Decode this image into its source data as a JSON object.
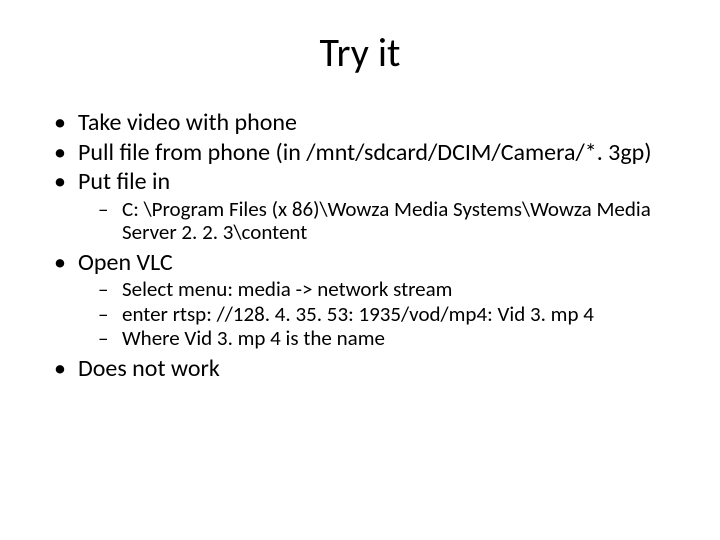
{
  "title": "Try it",
  "bullets": {
    "b1": "Take video with phone",
    "b2": "Pull file from phone (in /mnt/sdcard/DCIM/Camera/*. 3gp)",
    "b3": "Put file in",
    "b3s1": "C: \\Program Files (x 86)\\Wowza Media Systems\\Wowza Media Server 2. 2. 3\\content",
    "b4": "Open VLC",
    "b4s1": "Select menu: media -> network stream",
    "b4s2": "enter rtsp: //128. 4. 35. 53: 1935/vod/mp4: Vid 3. mp 4",
    "b4s3": "Where Vid 3. mp 4 is the name",
    "b5": "Does not work"
  }
}
